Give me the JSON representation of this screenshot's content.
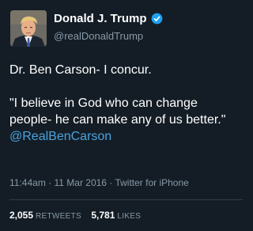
{
  "author": {
    "display_name": "Donald J. Trump",
    "handle": "@realDonaldTrump",
    "verified_icon": "verified-badge-icon",
    "avatar_icon": "profile-photo"
  },
  "tweet": {
    "line1": "Dr. Ben Carson- I concur.",
    "quote": "\"I believe in God who can change people- he can make any of us better.\"",
    "mention": "@RealBenCarson"
  },
  "meta": {
    "time": "11:44am",
    "separator1": " · ",
    "date": "11 Mar 2016",
    "separator2": " · ",
    "source": "Twitter for iPhone"
  },
  "stats": {
    "retweets_count": "2,055",
    "retweets_label": "RETWEETS",
    "likes_count": "5,781",
    "likes_label": "LIKES"
  },
  "colors": {
    "background": "#141d26",
    "link": "#4aa3df",
    "muted": "#8899a6",
    "verified": "#1da1f2"
  }
}
